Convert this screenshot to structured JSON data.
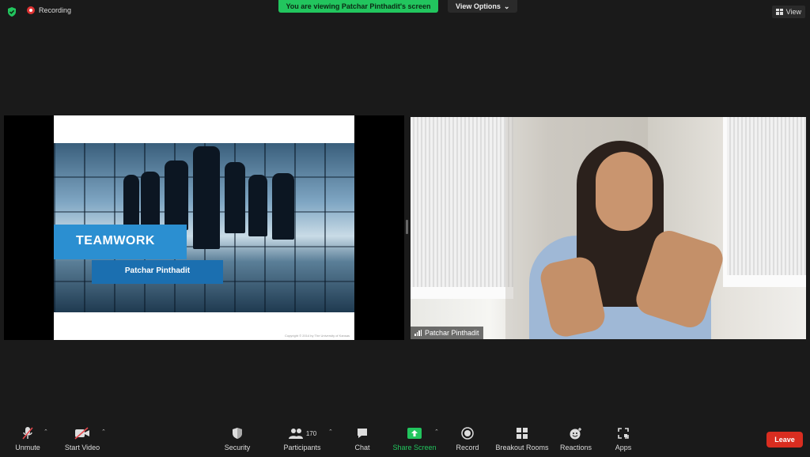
{
  "top": {
    "recording_label": "Recording",
    "banner_text": "You are viewing Patchar Pinthadit's screen",
    "view_options_label": "View Options",
    "view_label": "View"
  },
  "slide": {
    "title": "TEAMWORK",
    "presenter": "Patchar Pinthadit",
    "copyright": "Copyright © 2014 by The University of Kansas"
  },
  "video": {
    "participant_name": "Patchar Pinthadit"
  },
  "toolbar": {
    "unmute": "Unmute",
    "start_video": "Start Video",
    "security": "Security",
    "participants": "Participants",
    "participant_count": "170",
    "chat": "Chat",
    "share_screen": "Share Screen",
    "record": "Record",
    "breakout_rooms": "Breakout Rooms",
    "reactions": "Reactions",
    "apps": "Apps",
    "leave": "Leave"
  },
  "colors": {
    "accent_green": "#22c55e",
    "leave_red": "#d92d20",
    "slide_blue": "#2b8fd1"
  }
}
